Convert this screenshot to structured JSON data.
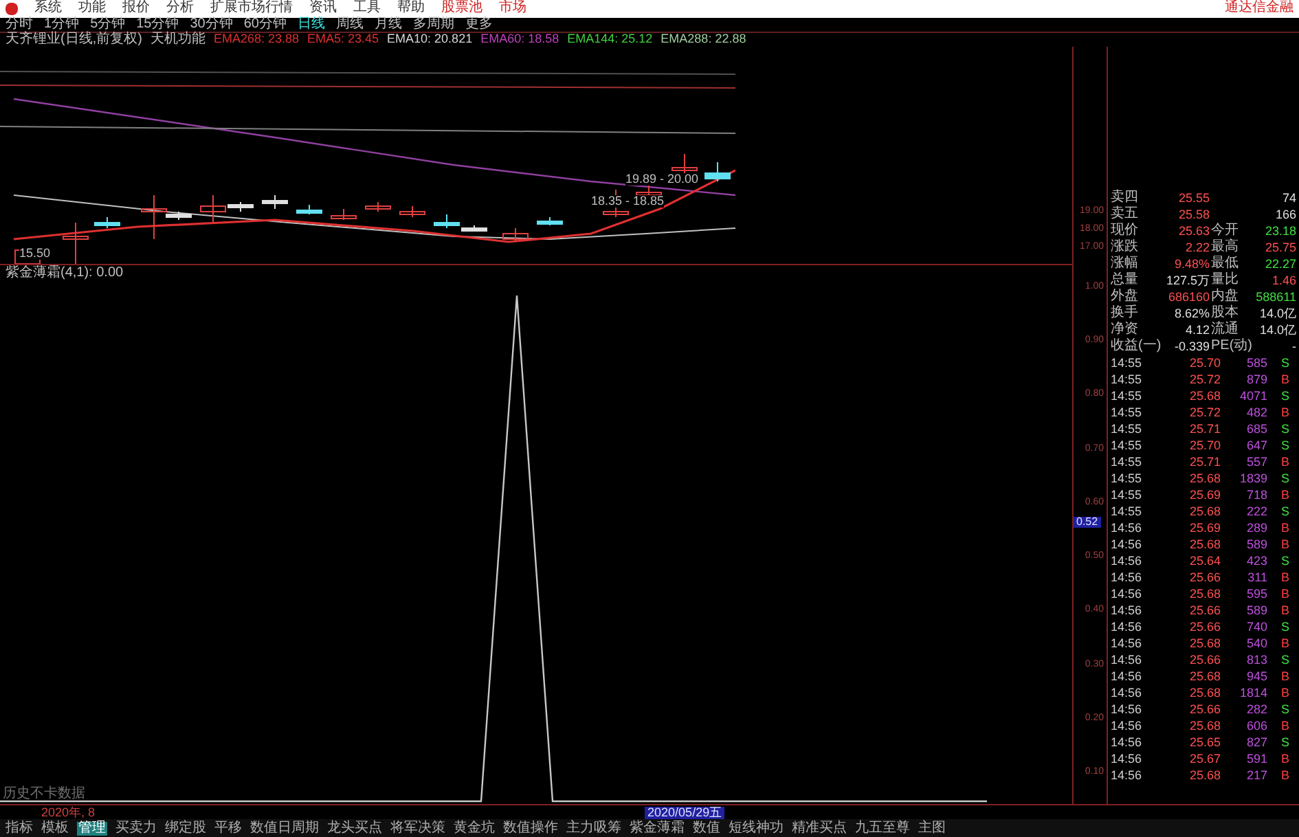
{
  "menu": {
    "items": [
      "系统",
      "功能",
      "报价",
      "分析",
      "扩展市场行情",
      "资讯",
      "工具",
      "帮助"
    ],
    "highlighted": [
      "股票池",
      "市场"
    ],
    "brand": "通达信金融"
  },
  "periods": [
    {
      "label": "分时",
      "selected": false
    },
    {
      "label": "1分钟",
      "selected": false
    },
    {
      "label": "5分钟",
      "selected": false
    },
    {
      "label": "15分钟",
      "selected": false
    },
    {
      "label": "30分钟",
      "selected": false
    },
    {
      "label": "60分钟",
      "selected": false
    },
    {
      "label": "日线",
      "selected": true
    },
    {
      "label": "周线",
      "selected": false
    },
    {
      "label": "月线",
      "selected": false
    },
    {
      "label": "多周期",
      "selected": false
    },
    {
      "label": "更多",
      "selected": false
    }
  ],
  "legend": {
    "stock": "天齐锂业(日线,前复权)",
    "formula": "天机功能",
    "lines": [
      {
        "text": "EMA268: 23.88",
        "color": "#e03030"
      },
      {
        "text": "EMA5: 23.45",
        "color": "#e03030"
      },
      {
        "text": "EMA10: 20.821",
        "color": "#d8d8d8"
      },
      {
        "text": "EMA60: 18.58",
        "color": "#c040c0"
      },
      {
        "text": "EMA144: 25.12",
        "color": "#40d040"
      },
      {
        "text": "EMA288: 22.88",
        "color": "#a0d0a0"
      }
    ]
  },
  "price_chart": {
    "labels": [
      "15.50",
      "19.89 - 20.00",
      "18.35 - 18.85"
    ],
    "axis": [
      "19.00",
      "18.00",
      "17.00"
    ]
  },
  "indicator": {
    "title": "紫金薄霜(4,1): 0.00",
    "axis": [
      "1.00",
      "0.90",
      "0.80",
      "0.70",
      "0.60",
      "0.50",
      "0.40",
      "0.30",
      "0.20",
      "0.10"
    ],
    "cursor": "0.52",
    "note": "历史不卡数据"
  },
  "quote": [
    {
      "left": {
        "label": "卖四",
        "value": "25.55",
        "color": "#ff5050"
      },
      "right": {
        "value": "74",
        "color": "#e0e0e0"
      }
    },
    {
      "left": {
        "label": "卖五",
        "value": "25.58",
        "color": "#ff5050"
      },
      "right": {
        "value": "166",
        "color": "#e0e0e0"
      }
    },
    {
      "left": {
        "label": "现价",
        "value": "25.63",
        "color": "#ff5050"
      },
      "right": {
        "label": "今开",
        "value": "23.18",
        "color": "#40e040"
      }
    },
    {
      "left": {
        "label": "涨跌",
        "value": "2.22",
        "color": "#ff5050"
      },
      "right": {
        "label": "最高",
        "value": "25.75",
        "color": "#ff5050"
      }
    },
    {
      "left": {
        "label": "涨幅",
        "value": "9.48%",
        "color": "#ff5050"
      },
      "right": {
        "label": "最低",
        "value": "22.27",
        "color": "#40e040"
      }
    },
    {
      "left": {
        "label": "总量",
        "value": "127.5万",
        "color": "#e0e0e0"
      },
      "right": {
        "label": "量比",
        "value": "1.46",
        "color": "#ff5050"
      }
    },
    {
      "left": {
        "label": "外盘",
        "value": "686160",
        "color": "#ff5050"
      },
      "right": {
        "label": "内盘",
        "value": "588611",
        "color": "#40e040"
      }
    },
    {
      "left": {
        "label": "换手",
        "value": "8.62%",
        "color": "#e0e0e0"
      },
      "right": {
        "label": "股本",
        "value": "14.0亿",
        "color": "#e0e0e0"
      }
    },
    {
      "left": {
        "label": "净资",
        "value": "4.12",
        "color": "#e0e0e0"
      },
      "right": {
        "label": "流通",
        "value": "14.0亿",
        "color": "#e0e0e0"
      }
    },
    {
      "left": {
        "label": "收益(一)",
        "value": "-0.339",
        "color": "#e0e0e0"
      },
      "right": {
        "label": "PE(动)",
        "value": "-"
      }
    }
  ],
  "ticks": [
    {
      "time": "14:55",
      "price": "25.70",
      "vol": "585",
      "side": "S"
    },
    {
      "time": "14:55",
      "price": "25.72",
      "vol": "879",
      "side": "B"
    },
    {
      "time": "14:55",
      "price": "25.68",
      "vol": "4071",
      "side": "S"
    },
    {
      "time": "14:55",
      "price": "25.72",
      "vol": "482",
      "side": "B"
    },
    {
      "time": "14:55",
      "price": "25.71",
      "vol": "685",
      "side": "S"
    },
    {
      "time": "14:55",
      "price": "25.70",
      "vol": "647",
      "side": "S"
    },
    {
      "time": "14:55",
      "price": "25.71",
      "vol": "557",
      "side": "B"
    },
    {
      "time": "14:55",
      "price": "25.68",
      "vol": "1839",
      "side": "S"
    },
    {
      "time": "14:55",
      "price": "25.69",
      "vol": "718",
      "side": "B"
    },
    {
      "time": "14:55",
      "price": "25.68",
      "vol": "222",
      "side": "S"
    },
    {
      "time": "14:56",
      "price": "25.69",
      "vol": "289",
      "side": "B"
    },
    {
      "time": "14:56",
      "price": "25.68",
      "vol": "589",
      "side": "B"
    },
    {
      "time": "14:56",
      "price": "25.64",
      "vol": "423",
      "side": "S"
    },
    {
      "time": "14:56",
      "price": "25.66",
      "vol": "311",
      "side": "B"
    },
    {
      "time": "14:56",
      "price": "25.68",
      "vol": "595",
      "side": "B"
    },
    {
      "time": "14:56",
      "price": "25.66",
      "vol": "589",
      "side": "B"
    },
    {
      "time": "14:56",
      "price": "25.66",
      "vol": "740",
      "side": "S"
    },
    {
      "time": "14:56",
      "price": "25.68",
      "vol": "540",
      "side": "B"
    },
    {
      "time": "14:56",
      "price": "25.66",
      "vol": "813",
      "side": "S"
    },
    {
      "time": "14:56",
      "price": "25.68",
      "vol": "945",
      "side": "B"
    },
    {
      "time": "14:56",
      "price": "25.68",
      "vol": "1814",
      "side": "B"
    },
    {
      "time": "14:56",
      "price": "25.66",
      "vol": "282",
      "side": "S"
    },
    {
      "time": "14:56",
      "price": "25.68",
      "vol": "606",
      "side": "B"
    },
    {
      "time": "14:56",
      "price": "25.65",
      "vol": "827",
      "side": "S"
    },
    {
      "time": "14:56",
      "price": "25.67",
      "vol": "591",
      "side": "B"
    },
    {
      "time": "14:56",
      "price": "25.68",
      "vol": "217",
      "side": "B"
    }
  ],
  "xaxis": {
    "left": "2020年, 8",
    "date": "2020/05/29五"
  },
  "tabs": [
    {
      "label": "指标",
      "selected": false
    },
    {
      "label": "模板",
      "selected": false
    },
    {
      "label": "管理",
      "selected": true
    },
    {
      "label": "买卖力",
      "selected": false
    },
    {
      "label": "绑定股",
      "selected": false
    },
    {
      "label": "平移",
      "selected": false
    },
    {
      "label": "数值日周期",
      "selected": false
    },
    {
      "label": "龙头买点",
      "selected": false
    },
    {
      "label": "将军决策",
      "selected": false
    },
    {
      "label": "黄金坑",
      "selected": false
    },
    {
      "label": "数值操作",
      "selected": false
    },
    {
      "label": "主力吸筹",
      "selected": false
    },
    {
      "label": "紫金薄霜",
      "selected": false
    },
    {
      "label": "数值",
      "selected": false
    },
    {
      "label": "短线神功",
      "selected": false
    },
    {
      "label": "精准买点",
      "selected": false
    },
    {
      "label": "九五至尊",
      "selected": false
    },
    {
      "label": "主图",
      "selected": false
    }
  ]
}
